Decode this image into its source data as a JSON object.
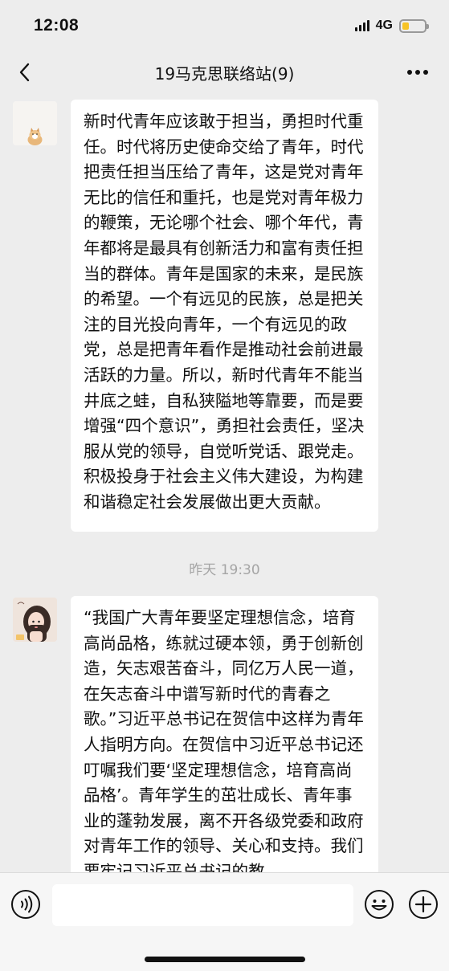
{
  "status_bar": {
    "time": "12:08",
    "network": "4G",
    "battery_level": 0.3,
    "battery_color": "#f7c325"
  },
  "nav": {
    "title": "19马克思联络站(9)",
    "back_icon": "chevron-left-icon",
    "more_icon": "more-dots-icon"
  },
  "messages": [
    {
      "text": "新时代青年应该敢于担当，勇担时代重任。时代将历史使命交给了青年，时代把责任担当压给了青年，这是党对青年无比的信任和重托，也是党对青年极力的鞭策，无论哪个社会、哪个年代，青年都将是最具有创新活力和富有责任担当的群体。青年是国家的未来，是民族的希望。一个有远见的民族，总是把关注的目光投向青年，一个有远见的政党，总是把青年看作是推动社会前进最活跃的力量。所以，新时代青年不能当井底之蛙，自私狭隘地等靠要，而是要增强“四个意识”，勇担社会责任，坚决服从党的领导，自觉听党话、跟党走。积极投身于社会主义伟大建设，为构建和谐稳定社会发展做出更大贡献。"
    },
    {
      "text": "“我国广大青年要坚定理想信念，培育高尚品格，练就过硬本领，勇于创新创造，矢志艰苦奋斗，同亿万人民一道，在矢志奋斗中谱写新时代的青春之歌。”习近平总书记在贺信中这样为青年人指明方向。在贺信中习近平总书记还叮嘱我们要‘坚定理想信念，培育高尚品格’。青年学生的茁壮成长、青年事业的蓬勃发展，离不开各级党委和政府对青年工作的领导、关心和支持。我们要牢记习近平总书记的教"
    }
  ],
  "timestamp": "昨天 19:30",
  "input_bar": {
    "voice_icon": "voice-icon",
    "emoji_icon": "emoji-icon",
    "plus_icon": "plus-icon",
    "input_value": ""
  }
}
